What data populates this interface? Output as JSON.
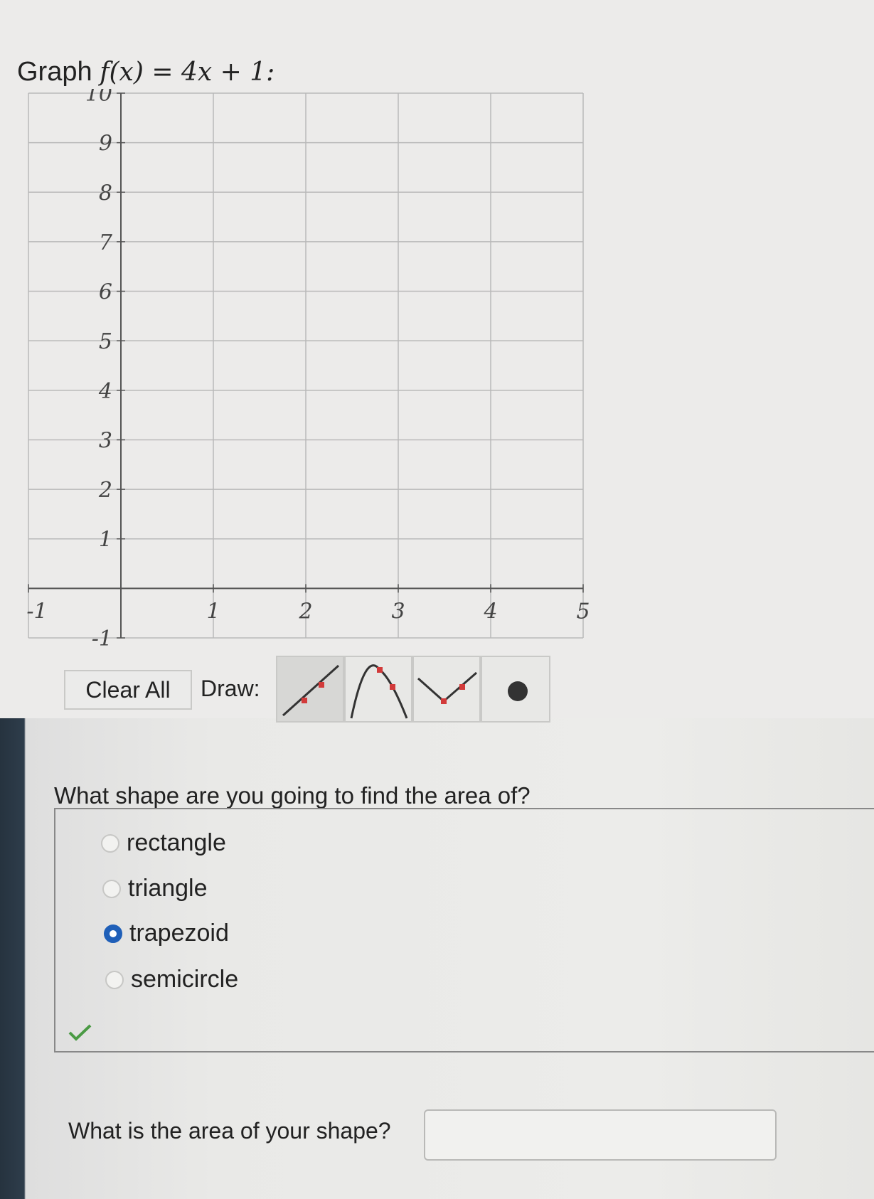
{
  "prompt": {
    "label": "Graph",
    "equation": "f(x) = 4x + 1:"
  },
  "graph": {
    "x_range": [
      -1,
      5
    ],
    "y_range": [
      -1,
      10
    ],
    "x_ticks": [
      "-1",
      "1",
      "2",
      "3",
      "4",
      "5"
    ],
    "y_ticks": [
      "10",
      "9",
      "8",
      "7",
      "6",
      "5",
      "4",
      "3",
      "2",
      "1",
      "-1"
    ],
    "grid": true
  },
  "toolbar": {
    "clear_label": "Clear All",
    "draw_label": "Draw:",
    "tools": [
      "line-tool-icon",
      "parabola-tool-icon",
      "absolute-value-tool-icon",
      "point-tool-icon"
    ],
    "active_tool": "line-tool-icon"
  },
  "question1": {
    "text": "What shape are you going to find the area of?",
    "options": [
      "rectangle",
      "triangle",
      "trapezoid",
      "semicircle"
    ],
    "selected": "trapezoid",
    "status_icon": "checkmark-icon"
  },
  "question2": {
    "text": "What is the area of your shape?",
    "value": ""
  },
  "colors": {
    "accent": "#1f5fb8",
    "handle": "#d23a3a",
    "check": "#4a9a44"
  }
}
